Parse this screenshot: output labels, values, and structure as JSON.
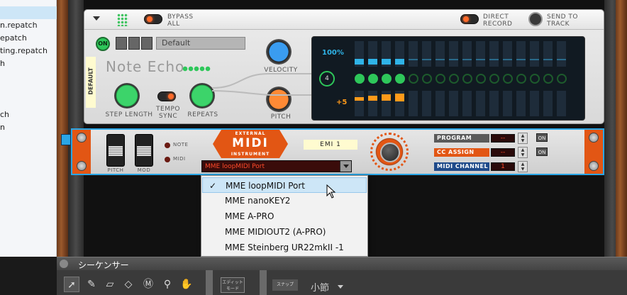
{
  "sidebar": {
    "items": [
      {
        "label": ""
      },
      {
        "label": "n.repatch"
      },
      {
        "label": "epatch"
      },
      {
        "label": "ting.repatch"
      },
      {
        "label": "h"
      },
      {
        "label": "ch"
      },
      {
        "label": "n"
      }
    ]
  },
  "note_echo": {
    "bypass_label": "BYPASS ALL",
    "direct_record_label": "DIRECT RECORD",
    "send_to_track_label": "SEND TO TRACK",
    "on_label": "ON",
    "patch_name": "Default",
    "side_label": "DEFAULT",
    "device_name": "Note Echo",
    "velocity_label": "VELOCITY",
    "pitch_label": "PITCH",
    "step_length_label": "STEP LENGTH",
    "tempo_sync_label": "TEMPO SYNC",
    "repeats_label": "REPEATS",
    "display": {
      "velocity_readout": "100%",
      "step_count": "4",
      "pitch_readout": "+5"
    }
  },
  "midi_device": {
    "logo_top": "EXTERNAL",
    "logo_main": "MIDI",
    "logo_bottom": "INSTRUMENT",
    "device_label": "EMI 1",
    "note_label": "NOTE",
    "midi_label": "MIDI",
    "pitch_label": "PITCH",
    "mod_label": "MOD",
    "port_selected": "MME loopMIDI Port",
    "program_label": "PROGRAM",
    "cc_assign_label": "CC ASSIGN",
    "midi_channel_label": "MIDI CHANNEL",
    "program_value": "--",
    "cc_value": "--",
    "channel_value": "1",
    "on_label": "ON"
  },
  "port_dropdown": {
    "check_glyph": "✓",
    "options": [
      {
        "label": "MME loopMIDI Port",
        "selected": true
      },
      {
        "label": "MME nanoKEY2",
        "selected": false
      },
      {
        "label": "MME A-PRO",
        "selected": false
      },
      {
        "label": "MME MIDIOUT2 (A-PRO)",
        "selected": false
      },
      {
        "label": "MME Steinberg UR22mkII -1",
        "selected": false
      }
    ]
  },
  "sequencer": {
    "title": "シーケンサー",
    "edit_mode_line1": "エディット",
    "edit_mode_line2": "モード",
    "snap_label": "スナップ",
    "snap_value": "小節",
    "tools": [
      "arrow-tool-icon",
      "pencil-tool-icon",
      "eraser-tool-icon",
      "razor-tool-icon",
      "mute-tool-icon",
      "magnify-tool-icon",
      "hand-tool-icon"
    ]
  },
  "colors": {
    "accent_blue": "#2aa6e6",
    "midi_orange": "#e25614",
    "green_led": "#2ec75a",
    "velocity_bar": "#2fb4e8",
    "pitch_bar": "#ff9a1a"
  }
}
